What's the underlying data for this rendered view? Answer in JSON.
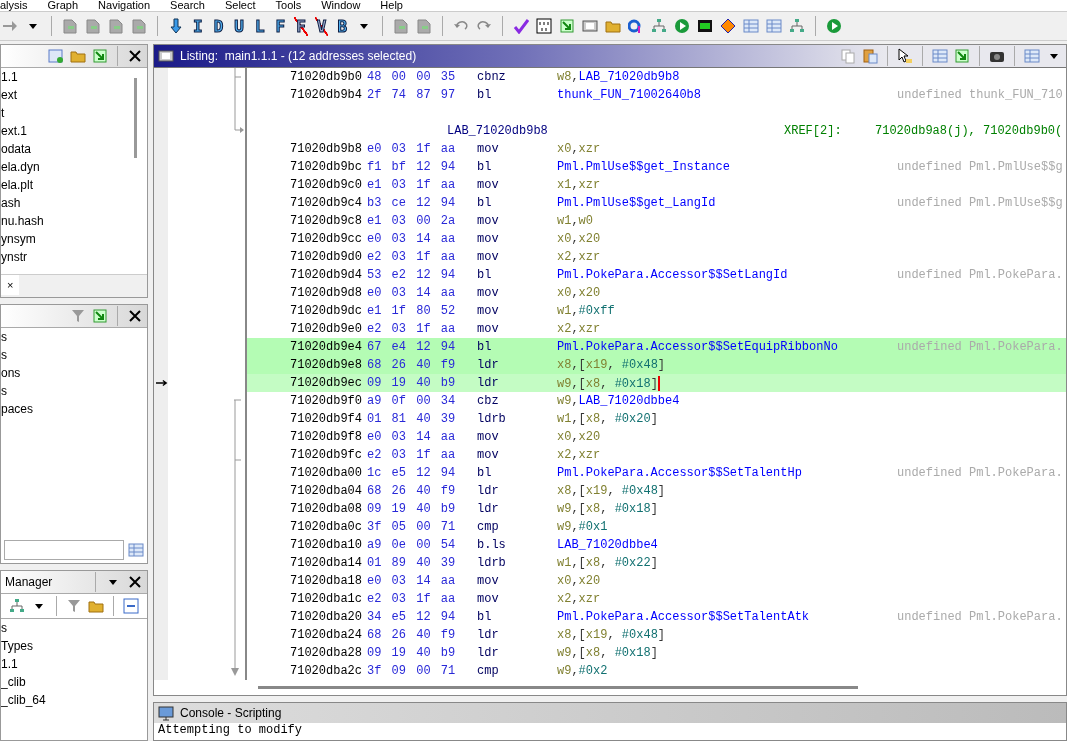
{
  "menu_bar": [
    "alysis",
    "Graph",
    "Navigation",
    "Search",
    "Select",
    "Tools",
    "Window",
    "Help"
  ],
  "toolbar_letters": [
    {
      "label": "I",
      "crossed": false
    },
    {
      "label": "D",
      "crossed": false
    },
    {
      "label": "U",
      "crossed": false
    },
    {
      "label": "L",
      "crossed": false
    },
    {
      "label": "F",
      "crossed": false
    },
    {
      "label": "F",
      "crossed": true
    },
    {
      "label": "V",
      "crossed": true
    },
    {
      "label": "B",
      "crossed": false
    }
  ],
  "program_tree": {
    "items": [
      "1.1",
      "ext",
      "t",
      "ext.1",
      "odata",
      "ela.dyn",
      "ela.plt",
      "ash",
      "nu.hash",
      "ynsym",
      "ynstr"
    ],
    "tab_close": "×"
  },
  "symbol_tree": {
    "items": [
      "s",
      "s",
      "ons",
      "s",
      "paces"
    ]
  },
  "data_type_manager": {
    "title": "Manager",
    "items": [
      "s",
      "Types",
      "1.1",
      "_clib",
      "_clib_64"
    ]
  },
  "listing": {
    "title": "Listing:  main1.1.1 - (12 addresses selected)",
    "rows": [
      {
        "kind": "instruction",
        "address": "71020db9b0",
        "bytes": "48 00 00 35",
        "mnemonic": "cbnz",
        "operands": "w8,LAB_71020db9b8",
        "selected": false,
        "cursor": false
      },
      {
        "kind": "instruction",
        "address": "71020db9b4",
        "bytes": "2f 74 87 97",
        "mnemonic": "bl",
        "operands": "thunk_FUN_71002640b8",
        "comment": "undefined thunk_FUN_710",
        "selected": false,
        "cursor": false
      },
      {
        "kind": "blank"
      },
      {
        "kind": "label",
        "label": "LAB_71020db9b8",
        "xref": "XREF[2]:",
        "refs": "71020db9a8(j), 71020db9b0("
      },
      {
        "kind": "instruction",
        "address": "71020db9b8",
        "bytes": "e0 03 1f aa",
        "mnemonic": "mov",
        "operands": "x0,xzr",
        "selected": false,
        "cursor": false
      },
      {
        "kind": "instruction",
        "address": "71020db9bc",
        "bytes": "f1 bf 12 94",
        "mnemonic": "bl",
        "operands": "Pml.PmlUse$$get_Instance",
        "comment": "undefined Pml.PmlUse$$g",
        "selected": false,
        "cursor": false
      },
      {
        "kind": "instruction",
        "address": "71020db9c0",
        "bytes": "e1 03 1f aa",
        "mnemonic": "mov",
        "operands": "x1,xzr",
        "selected": false,
        "cursor": false
      },
      {
        "kind": "instruction",
        "address": "71020db9c4",
        "bytes": "b3 ce 12 94",
        "mnemonic": "bl",
        "operands": "Pml.PmlUse$$get_LangId",
        "comment": "undefined Pml.PmlUse$$g",
        "selected": false,
        "cursor": false
      },
      {
        "kind": "instruction",
        "address": "71020db9c8",
        "bytes": "e1 03 00 2a",
        "mnemonic": "mov",
        "operands": "w1,w0",
        "selected": false,
        "cursor": false
      },
      {
        "kind": "instruction",
        "address": "71020db9cc",
        "bytes": "e0 03 14 aa",
        "mnemonic": "mov",
        "operands": "x0,x20",
        "selected": false,
        "cursor": false
      },
      {
        "kind": "instruction",
        "address": "71020db9d0",
        "bytes": "e2 03 1f aa",
        "mnemonic": "mov",
        "operands": "x2,xzr",
        "selected": false,
        "cursor": false
      },
      {
        "kind": "instruction",
        "address": "71020db9d4",
        "bytes": "53 e2 12 94",
        "mnemonic": "bl",
        "operands": "Pml.PokePara.Accessor$$SetLangId",
        "comment": "undefined Pml.PokePara.",
        "selected": false,
        "cursor": false
      },
      {
        "kind": "instruction",
        "address": "71020db9d8",
        "bytes": "e0 03 14 aa",
        "mnemonic": "mov",
        "operands": "x0,x20",
        "selected": false,
        "cursor": false
      },
      {
        "kind": "instruction",
        "address": "71020db9dc",
        "bytes": "e1 1f 80 52",
        "mnemonic": "mov",
        "operands": "w1,#0xff",
        "selected": false,
        "cursor": false
      },
      {
        "kind": "instruction",
        "address": "71020db9e0",
        "bytes": "e2 03 1f aa",
        "mnemonic": "mov",
        "operands": "x2,xzr",
        "selected": false,
        "cursor": false
      },
      {
        "kind": "instruction",
        "address": "71020db9e4",
        "bytes": "67 e4 12 94",
        "mnemonic": "bl",
        "operands": "Pml.PokePara.Accessor$$SetEquipRibbonNo",
        "comment": "undefined Pml.PokePara.",
        "selected": true,
        "cursor": false
      },
      {
        "kind": "instruction",
        "address": "71020db9e8",
        "bytes": "68 26 40 f9",
        "mnemonic": "ldr",
        "operands": "x8,[x19, #0x48]",
        "selected": true,
        "cursor": false
      },
      {
        "kind": "instruction",
        "address": "71020db9ec",
        "bytes": "09 19 40 b9",
        "mnemonic": "ldr",
        "operands": "w9,[x8, #0x18]",
        "selected": true,
        "cursor": true
      },
      {
        "kind": "instruction",
        "address": "71020db9f0",
        "bytes": "a9 0f 00 34",
        "mnemonic": "cbz",
        "operands": "w9,LAB_71020dbbe4",
        "selected": false,
        "cursor": false
      },
      {
        "kind": "instruction",
        "address": "71020db9f4",
        "bytes": "01 81 40 39",
        "mnemonic": "ldrb",
        "operands": "w1,[x8, #0x20]",
        "selected": false,
        "cursor": false
      },
      {
        "kind": "instruction",
        "address": "71020db9f8",
        "bytes": "e0 03 14 aa",
        "mnemonic": "mov",
        "operands": "x0,x20",
        "selected": false,
        "cursor": false
      },
      {
        "kind": "instruction",
        "address": "71020db9fc",
        "bytes": "e2 03 1f aa",
        "mnemonic": "mov",
        "operands": "x2,xzr",
        "selected": false,
        "cursor": false
      },
      {
        "kind": "instruction",
        "address": "71020dba00",
        "bytes": "1c e5 12 94",
        "mnemonic": "bl",
        "operands": "Pml.PokePara.Accessor$$SetTalentHp",
        "comment": "undefined Pml.PokePara.",
        "selected": false,
        "cursor": false
      },
      {
        "kind": "instruction",
        "address": "71020dba04",
        "bytes": "68 26 40 f9",
        "mnemonic": "ldr",
        "operands": "x8,[x19, #0x48]",
        "selected": false,
        "cursor": false
      },
      {
        "kind": "instruction",
        "address": "71020dba08",
        "bytes": "09 19 40 b9",
        "mnemonic": "ldr",
        "operands": "w9,[x8, #0x18]",
        "selected": false,
        "cursor": false
      },
      {
        "kind": "instruction",
        "address": "71020dba0c",
        "bytes": "3f 05 00 71",
        "mnemonic": "cmp",
        "operands": "w9,#0x1",
        "selected": false,
        "cursor": false
      },
      {
        "kind": "instruction",
        "address": "71020dba10",
        "bytes": "a9 0e 00 54",
        "mnemonic": "b.ls",
        "operands": "LAB_71020dbbe4",
        "selected": false,
        "cursor": false
      },
      {
        "kind": "instruction",
        "address": "71020dba14",
        "bytes": "01 89 40 39",
        "mnemonic": "ldrb",
        "operands": "w1,[x8, #0x22]",
        "selected": false,
        "cursor": false
      },
      {
        "kind": "instruction",
        "address": "71020dba18",
        "bytes": "e0 03 14 aa",
        "mnemonic": "mov",
        "operands": "x0,x20",
        "selected": false,
        "cursor": false
      },
      {
        "kind": "instruction",
        "address": "71020dba1c",
        "bytes": "e2 03 1f aa",
        "mnemonic": "mov",
        "operands": "x2,xzr",
        "selected": false,
        "cursor": false
      },
      {
        "kind": "instruction",
        "address": "71020dba20",
        "bytes": "34 e5 12 94",
        "mnemonic": "bl",
        "operands": "Pml.PokePara.Accessor$$SetTalentAtk",
        "comment": "undefined Pml.PokePara.",
        "selected": false,
        "cursor": false
      },
      {
        "kind": "instruction",
        "address": "71020dba24",
        "bytes": "68 26 40 f9",
        "mnemonic": "ldr",
        "operands": "x8,[x19, #0x48]",
        "selected": false,
        "cursor": false
      },
      {
        "kind": "instruction",
        "address": "71020dba28",
        "bytes": "09 19 40 b9",
        "mnemonic": "ldr",
        "operands": "w9,[x8, #0x18]",
        "selected": false,
        "cursor": false
      },
      {
        "kind": "instruction",
        "address": "71020dba2c",
        "bytes": "3f 09 00 71",
        "mnemonic": "cmp",
        "operands": "w9,#0x2",
        "selected": false,
        "cursor": false
      }
    ]
  },
  "console": {
    "title": "Console - Scripting",
    "lines": [
      "Attempting to modify"
    ]
  }
}
